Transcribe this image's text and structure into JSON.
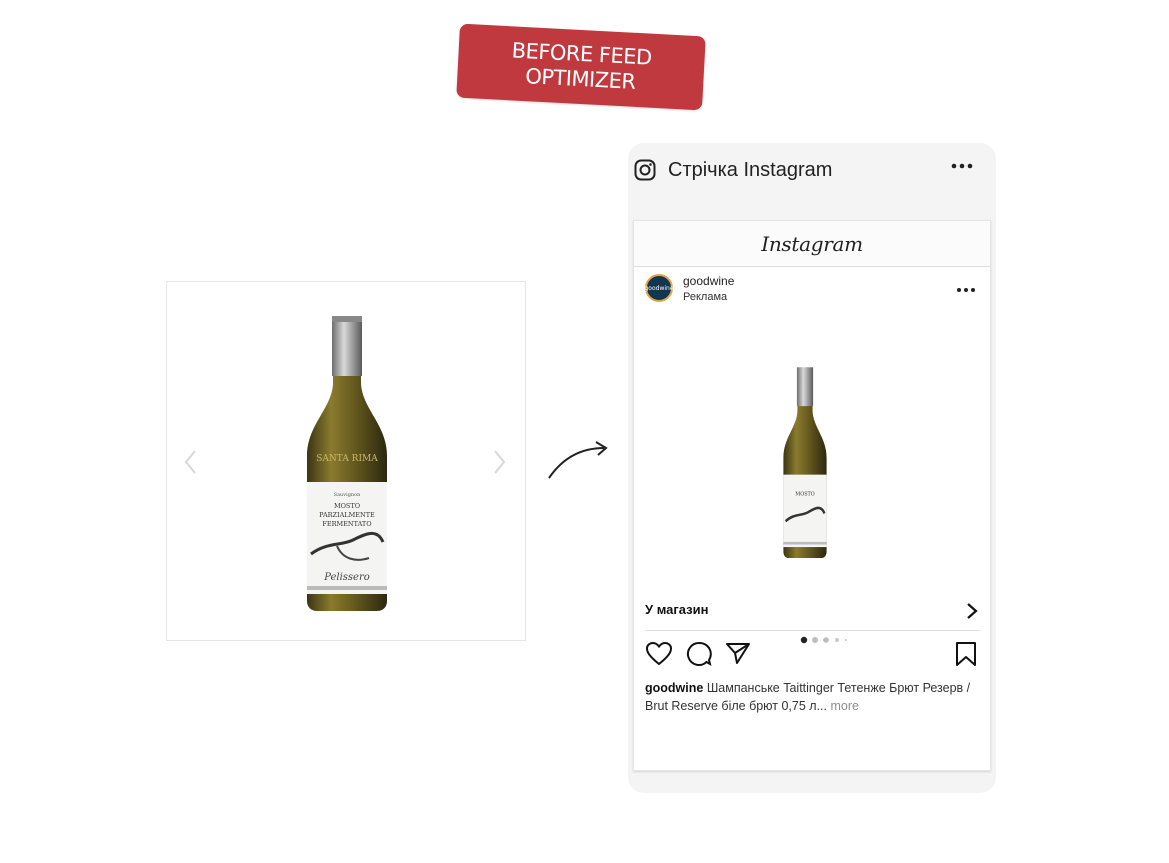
{
  "badge": {
    "line1": "BEFORE FEED",
    "line2": "OPTIMIZER"
  },
  "colors": {
    "badge": "#c0393f",
    "avatar": "#12364f",
    "avatar_ring": "#e0a548"
  },
  "product_gallery": {
    "prev_icon": "chevron-left-icon",
    "next_icon": "chevron-right-icon",
    "product_image": "wine-bottle"
  },
  "phone": {
    "title": "Стрічка Instagram",
    "icon": "instagram-icon",
    "menu_icon": "more-horizontal-icon"
  },
  "post": {
    "platform_logo": "Instagram",
    "avatar_text": "goodwine",
    "username": "goodwine",
    "sponsored": "Реклама",
    "cta": "У магазин",
    "caption_user": "goodwine",
    "caption_text": "Шампанське Taittinger Тетенже Брют Резерв / Brut Reserve біле брют 0,75 л...",
    "more": "more",
    "carousel_position": 1,
    "carousel_count": 5,
    "actions": [
      "heart-icon",
      "comment-icon",
      "share-icon",
      "bookmark-icon"
    ]
  }
}
